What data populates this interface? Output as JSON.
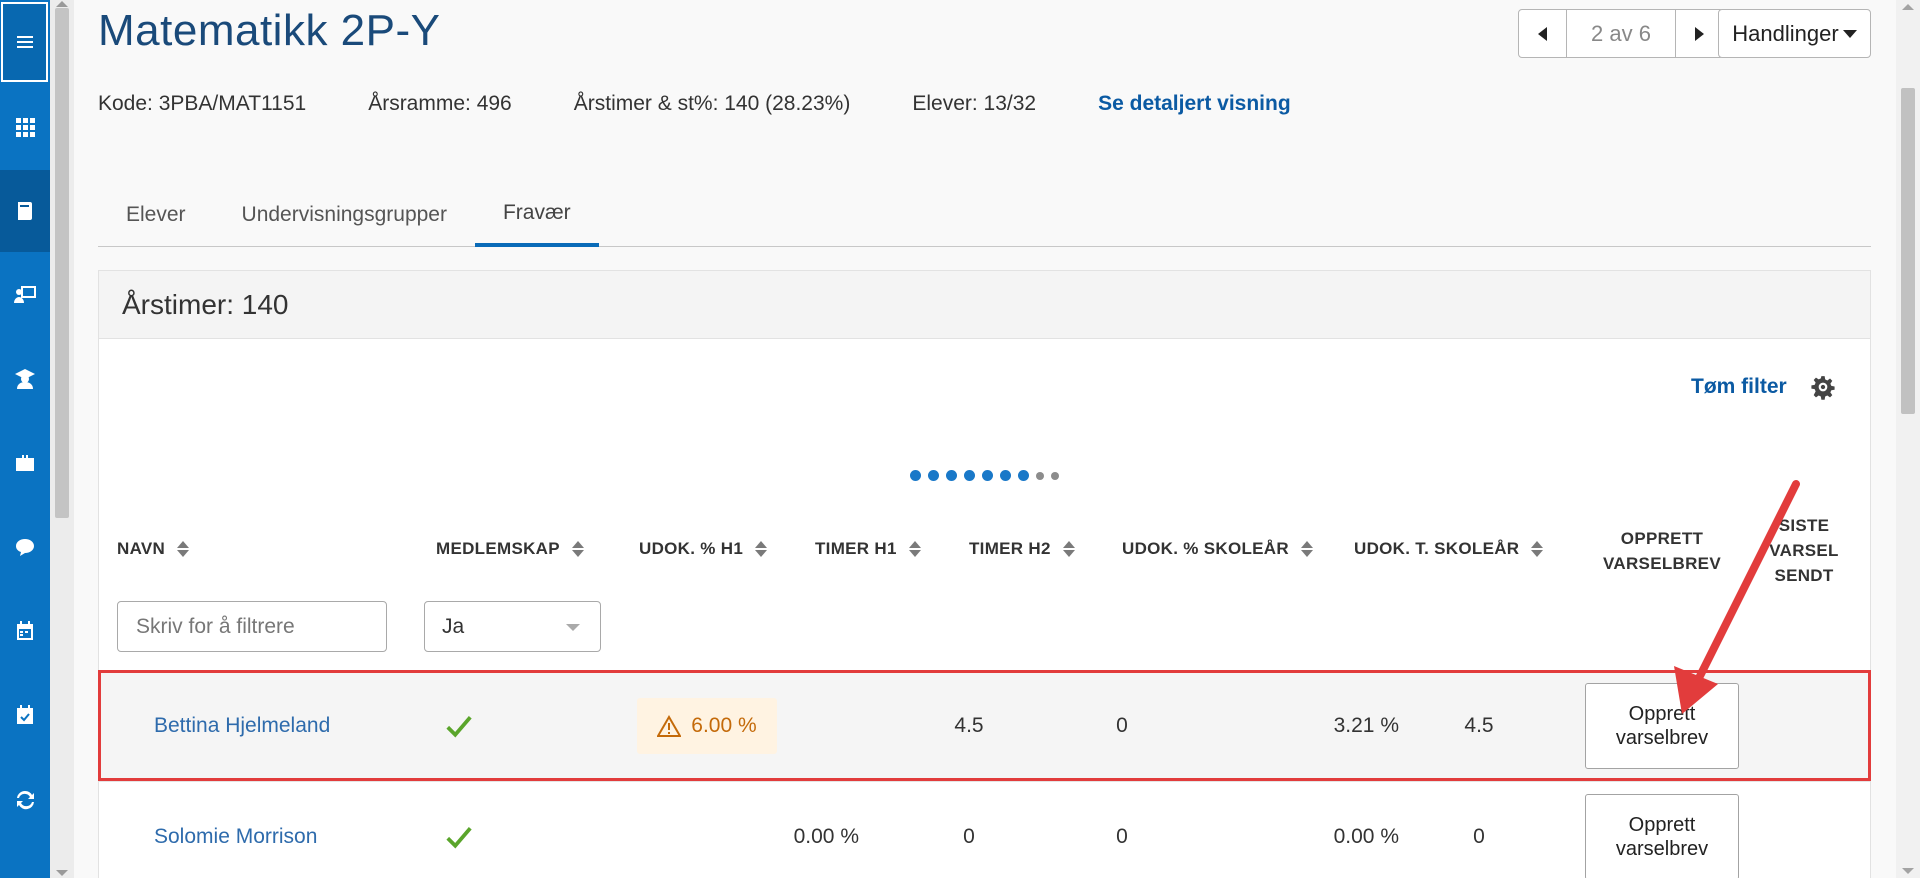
{
  "nav": {
    "items": [
      {
        "name": "menu-icon"
      },
      {
        "name": "apps-grid-icon"
      },
      {
        "name": "book-icon"
      },
      {
        "name": "teacher-board-icon"
      },
      {
        "name": "student-icon"
      },
      {
        "name": "briefcase-icon"
      },
      {
        "name": "chat-icon"
      },
      {
        "name": "calendar-icon"
      },
      {
        "name": "calendar-check-icon"
      },
      {
        "name": "sync-icon"
      }
    ]
  },
  "header": {
    "title": "Matematikk 2P-Y",
    "pager_text": "2 av 6",
    "actions_label": "Handlinger",
    "meta": {
      "kode": "Kode: 3PBA/MAT1151",
      "arsramme": "Årsramme: 496",
      "arstimer": "Årstimer & st%: 140 (28.23%)",
      "elever": "Elever: 13/32",
      "detail_link": "Se detaljert visning"
    }
  },
  "tabs": [
    {
      "label": "Elever",
      "active": false
    },
    {
      "label": "Undervisningsgrupper",
      "active": false
    },
    {
      "label": "Fravær",
      "active": true
    }
  ],
  "panel": {
    "title": "Årstimer: 140",
    "clear_filter": "Tøm filter",
    "columns": {
      "navn": "NAVN",
      "medlemskap": "MEDLEMSKAP",
      "udok_h1": "UDOK. % H1",
      "timer_h1": "TIMER H1",
      "timer_h2": "TIMER H2",
      "udok_skolear": "UDOK. % SKOLEÅR",
      "udok_t_skolear": "UDOK. T. SKOLEÅR",
      "opprett_line1": "OPPRETT",
      "opprett_line2": "VARSELBREV",
      "siste_line1": "SISTE",
      "siste_line2": "VARSEL",
      "siste_line3": "SENDT"
    },
    "filters": {
      "name_placeholder": "Skriv for å filtrere",
      "membership_value": "Ja"
    },
    "rows": [
      {
        "name": "Bettina Hjelmeland",
        "member": true,
        "udok_h1": "6.00 %",
        "udok_h1_warning": true,
        "timer_h1": "4.5",
        "timer_h2": "0",
        "udok_skolear": "3.21 %",
        "udok_t_skolear": "4.5",
        "create_line1": "Opprett",
        "create_line2": "varselbrev"
      },
      {
        "name": "Solomie Morrison",
        "member": true,
        "udok_h1": "0.00 %",
        "udok_h1_warning": false,
        "timer_h1": "0",
        "timer_h2": "0",
        "udok_skolear": "0.00 %",
        "udok_t_skolear": "0",
        "create_line1": "Opprett",
        "create_line2": "varselbrev"
      }
    ]
  },
  "colors": {
    "nav_bg": "#0a73c2",
    "accent_link": "#0b5aa3",
    "warning_bg": "#fff3e2",
    "warning_fg": "#c46a0a",
    "check_green": "#5aa52b",
    "annotation_red": "#e23c3c"
  }
}
